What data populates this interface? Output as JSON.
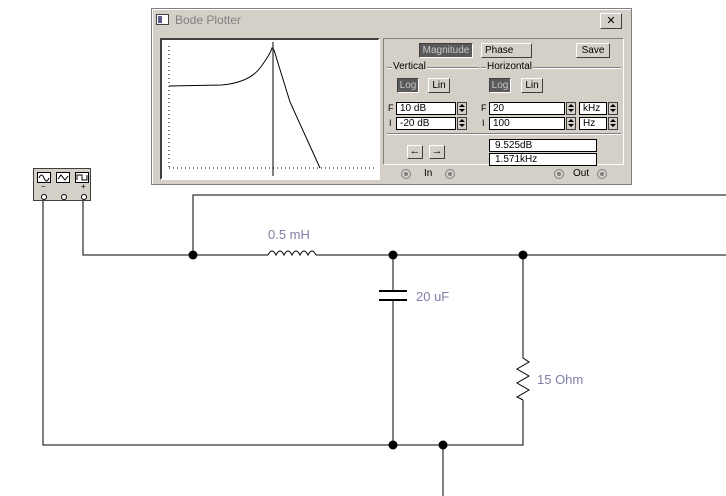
{
  "window": {
    "title": "Bode Plotter",
    "close_label": "✕"
  },
  "mode": {
    "magnitude_label": "Magnitude",
    "phase_label": "Phase",
    "save_label": "Save"
  },
  "vertical": {
    "label": "Vertical",
    "log_label": "Log",
    "lin_label": "Lin",
    "final_tag": "F",
    "initial_tag": "I",
    "final_value": "10 dB",
    "initial_value": "-20 dB",
    "scale": "log"
  },
  "horizontal": {
    "label": "Horizontal",
    "log_label": "Log",
    "lin_label": "Lin",
    "final_tag": "F",
    "initial_tag": "I",
    "final_value": "20",
    "final_unit": "kHz",
    "initial_value": "100",
    "initial_unit": "Hz",
    "scale": "log"
  },
  "readout": {
    "magnitude": "9.525dB",
    "frequency": "1.571kHz"
  },
  "cursor": {
    "left_arrow": "←",
    "right_arrow": "→"
  },
  "terminals": {
    "in_label": "In",
    "out_label": "Out"
  },
  "function_generator": {
    "minus_symbol": "−",
    "plus_symbol": "+",
    "common_symbol": ""
  },
  "circuit": {
    "inductor_label": "0.5 mH",
    "capacitor_label": "20 uF",
    "resistor_label": "15  Ohm"
  },
  "icons": [
    "app-icon",
    "close-icon",
    "sine-wave-icon",
    "triangle-wave-icon",
    "square-wave-icon",
    "left-arrow-icon",
    "right-arrow-icon"
  ]
}
